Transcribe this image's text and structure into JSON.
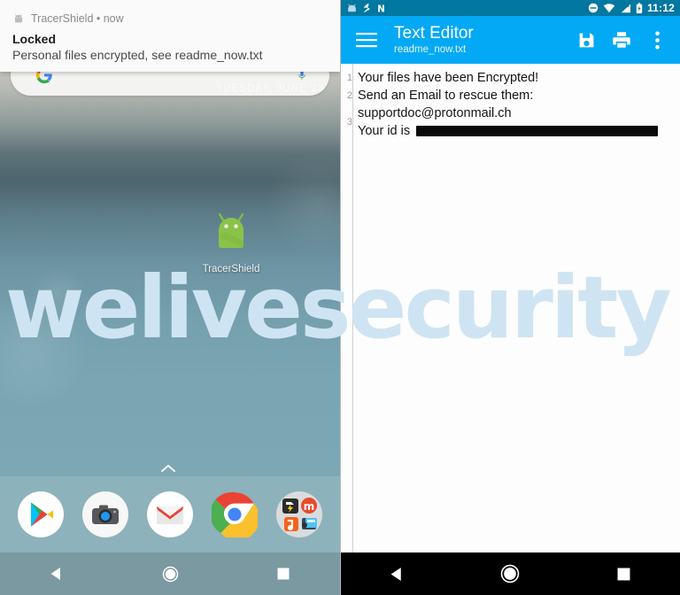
{
  "left": {
    "notification": {
      "app_icon": "android-robot-icon",
      "app_name": "TracerShield • now",
      "title": "Locked",
      "body": "Personal files encrypted, see readme_now.txt"
    },
    "home": {
      "date": "TUESDAY, JUNE 23",
      "search_placeholder": "",
      "search_icon": "google-g-icon",
      "mic_icon": "microphone-icon",
      "drawer_chevron_icon": "chevron-up-icon",
      "shortcut": {
        "icon": "android-robot-icon",
        "label": "TracerShield"
      }
    },
    "dock": [
      {
        "name": "play-store",
        "icon": "play-store-icon"
      },
      {
        "name": "camera",
        "icon": "camera-icon"
      },
      {
        "name": "gmail",
        "icon": "gmail-icon"
      },
      {
        "name": "chrome",
        "icon": "chrome-icon"
      },
      {
        "name": "folder",
        "icon": "app-folder-icon"
      }
    ],
    "navbar": [
      {
        "name": "back",
        "icon": "back-triangle-icon"
      },
      {
        "name": "home",
        "icon": "home-circle-icon"
      },
      {
        "name": "recents",
        "icon": "recents-square-icon"
      }
    ]
  },
  "right": {
    "statusbar": {
      "left_icons": [
        "android-robot-icon",
        "usb-debug-icon",
        "nfc-icon"
      ],
      "right_icons": [
        "do-not-disturb-icon",
        "wifi-icon",
        "cell-signal-icon",
        "battery-charging-icon"
      ],
      "time": "11:12"
    },
    "appbar": {
      "menu_icon": "hamburger-menu-icon",
      "title": "Text Editor",
      "subtitle": "readme_now.txt",
      "actions": [
        {
          "name": "save",
          "icon": "save-floppy-icon"
        },
        {
          "name": "print",
          "icon": "printer-icon"
        },
        {
          "name": "overflow",
          "icon": "overflow-menu-icon"
        }
      ]
    },
    "editor": {
      "line_numbers": [
        "1",
        "2",
        "3"
      ],
      "lines": [
        "Your files have been Encrypted!",
        "Send an Email to rescue them:",
        "supportdoc@protonmail.ch",
        "Your id is "
      ],
      "redacted_id_label": "redacted-id"
    },
    "navbar": [
      {
        "name": "back",
        "icon": "back-triangle-icon"
      },
      {
        "name": "home",
        "icon": "home-circle-icon"
      },
      {
        "name": "recents",
        "icon": "recents-square-icon"
      }
    ]
  },
  "watermark": {
    "text": "welivesecurity",
    "color": "#cfe4f2"
  },
  "colors": {
    "appbar": "#03a9f4",
    "statusbar": "#0277a0",
    "navbar": "#000000",
    "editor_bg": "#fdfdfd"
  }
}
